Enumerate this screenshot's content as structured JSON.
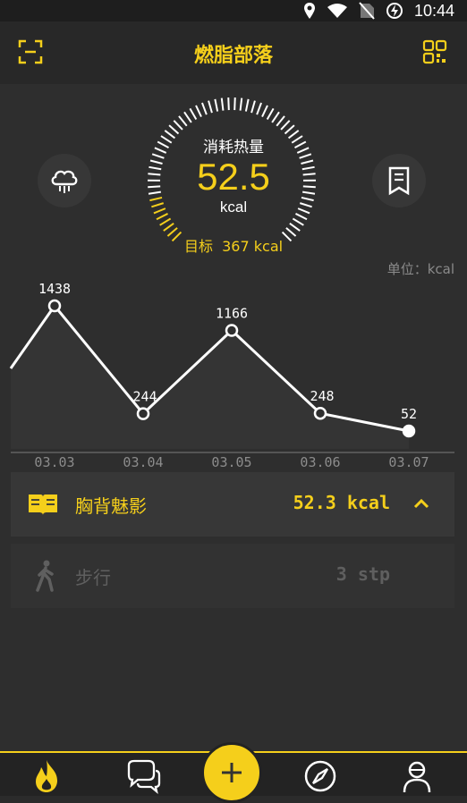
{
  "status_bar": {
    "time": "10:44",
    "icons": [
      "location-icon",
      "wifi-icon",
      "no-sim-icon",
      "battery-charging-icon"
    ]
  },
  "header": {
    "title": "燃脂部落",
    "left_icon": "scan-icon",
    "right_icon": "qr-code-icon"
  },
  "gauge": {
    "label": "消耗热量",
    "value": "52.5",
    "unit": "kcal",
    "target_label": "目标",
    "target_value": "367 kcal",
    "progress_fraction": 0.14
  },
  "side_buttons": {
    "left_icon": "cloud-rain-icon",
    "right_icon": "bookmark-note-icon"
  },
  "chart_unit": "单位：kcal",
  "chart_data": {
    "type": "line",
    "categories": [
      "03.03",
      "03.04",
      "03.05",
      "03.06",
      "03.07"
    ],
    "series": [
      {
        "values": [
          1438,
          244,
          1166,
          248,
          52
        ]
      }
    ],
    "data_labels": [
      "1438",
      "244",
      "1166",
      "248",
      "52"
    ],
    "title": "",
    "xlabel": "",
    "ylabel": ""
  },
  "activities": [
    {
      "icon": "open-book-icon",
      "name": "胸背魅影",
      "value": "52.3 kcal",
      "expand_icon": "chevron-up-icon",
      "active": true
    },
    {
      "icon": "walking-person-icon",
      "name": "步行",
      "value": "3 stp",
      "active": false
    }
  ],
  "bottom_nav": {
    "items": [
      "flame-icon",
      "chat-bubbles-icon",
      "compass-icon",
      "user-profile-icon"
    ],
    "fab_icon": "plus-icon"
  },
  "colors": {
    "accent": "#f5cf1b",
    "background": "#2e2e2e",
    "card": "#373737",
    "line": "#ffffff"
  }
}
